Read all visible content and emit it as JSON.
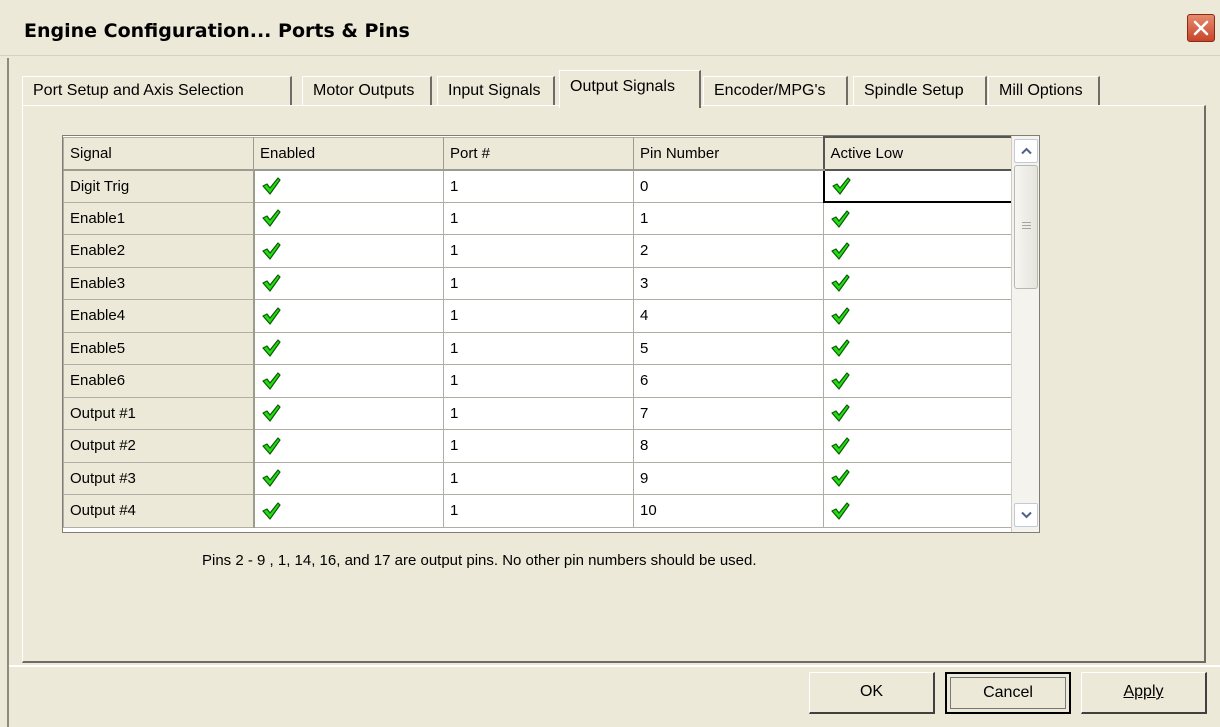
{
  "window": {
    "title": "Engine Configuration... Ports & Pins"
  },
  "tabs": [
    {
      "label": "Port Setup and Axis Selection",
      "active": false
    },
    {
      "label": "Motor Outputs",
      "active": false
    },
    {
      "label": "Input Signals",
      "active": false
    },
    {
      "label": "Output Signals",
      "active": true
    },
    {
      "label": "Encoder/MPG's",
      "active": false
    },
    {
      "label": "Spindle Setup",
      "active": false
    },
    {
      "label": "Mill Options",
      "active": false
    }
  ],
  "table": {
    "columns": [
      "Signal",
      "Enabled",
      "Port #",
      "Pin Number",
      "Active Low"
    ],
    "rows": [
      {
        "signal": "Digit  Trig",
        "enabled": true,
        "port": "1",
        "pin": "0",
        "active_low": true
      },
      {
        "signal": "Enable1",
        "enabled": true,
        "port": "1",
        "pin": "1",
        "active_low": true
      },
      {
        "signal": "Enable2",
        "enabled": true,
        "port": "1",
        "pin": "2",
        "active_low": true
      },
      {
        "signal": "Enable3",
        "enabled": true,
        "port": "1",
        "pin": "3",
        "active_low": true
      },
      {
        "signal": "Enable4",
        "enabled": true,
        "port": "1",
        "pin": "4",
        "active_low": true
      },
      {
        "signal": "Enable5",
        "enabled": true,
        "port": "1",
        "pin": "5",
        "active_low": true
      },
      {
        "signal": "Enable6",
        "enabled": true,
        "port": "1",
        "pin": "6",
        "active_low": true
      },
      {
        "signal": "Output #1",
        "enabled": true,
        "port": "1",
        "pin": "7",
        "active_low": true
      },
      {
        "signal": "Output #2",
        "enabled": true,
        "port": "1",
        "pin": "8",
        "active_low": true
      },
      {
        "signal": "Output #3",
        "enabled": true,
        "port": "1",
        "pin": "9",
        "active_low": true
      },
      {
        "signal": "Output #4",
        "enabled": true,
        "port": "1",
        "pin": "10",
        "active_low": true
      }
    ]
  },
  "hint": "Pins 2 - 9 , 1, 14, 16, and 17 are output pins. No  other pin numbers should be used.",
  "buttons": {
    "ok": "OK",
    "cancel": "Cancel",
    "apply": "Apply"
  },
  "icons": {
    "check": "green-check-icon",
    "close": "close-icon",
    "scroll_up": "arrow-up-icon",
    "scroll_down": "arrow-down-icon"
  },
  "colors": {
    "check_fill": "#22dd11",
    "check_stroke": "#0a5a05",
    "close_bg": "#d2573b"
  }
}
